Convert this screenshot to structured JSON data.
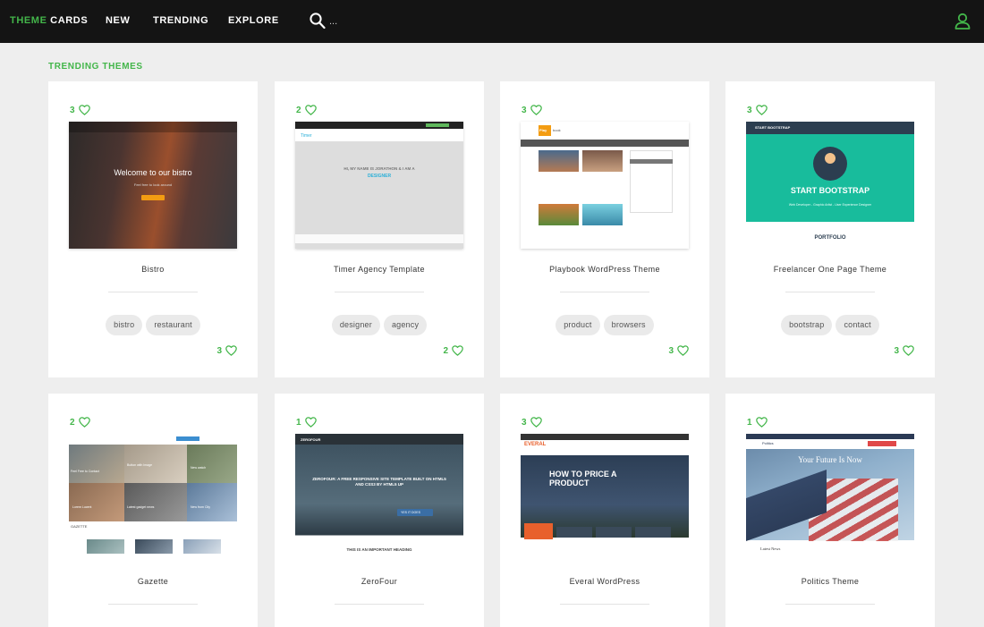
{
  "nav": {
    "brand_part1": "THEME",
    "brand_part2": "CARDS",
    "links": [
      "NEW",
      "TRENDING",
      "EXPLORE"
    ],
    "search_placeholder": "...",
    "icons": {
      "search": "search-icon",
      "user": "user-icon",
      "like": "heart-icon"
    }
  },
  "colors": {
    "accent": "#43b64a",
    "navbar": "#141414",
    "background": "#eeeeee",
    "card": "#ffffff"
  },
  "section_title": "TRENDING THEMES",
  "cards": [
    {
      "title": "Bistro",
      "likes_top": "3",
      "likes_bottom": "3",
      "tags": [
        "bistro",
        "restaurant"
      ],
      "thumb": {
        "headline": "Welcome to our bistro",
        "sub": "Feel free to look around"
      }
    },
    {
      "title": "Timer Agency Template",
      "likes_top": "2",
      "likes_bottom": "2",
      "tags": [
        "designer",
        "agency"
      ],
      "thumb": {
        "headline": "HI, MY NAME IS JORATHON & I AM A",
        "sub": "DESIGNER",
        "logo": "Timer"
      }
    },
    {
      "title": "Playbook WordPress Theme",
      "likes_top": "3",
      "likes_bottom": "3",
      "tags": [
        "product",
        "browsers"
      ],
      "thumb": {
        "logo": "Play",
        "logo_suffix": "book"
      }
    },
    {
      "title": "Freelancer One Page Theme",
      "likes_top": "3",
      "likes_bottom": "3",
      "tags": [
        "bootstrap",
        "contact"
      ],
      "thumb": {
        "nav_title": "START BOOTSTRAP",
        "headline": "START BOOTSTRAP",
        "sub": "Web Developer - Graphic Artist - User Experience Designer",
        "section": "PORTFOLIO"
      }
    },
    {
      "title": "Gazette",
      "likes_top": "2",
      "likes_bottom": "",
      "tags": [],
      "thumb": {
        "logo": "GAZETTE",
        "captions": [
          "Feel Free to Contact",
          "Button with Image",
          "New watch",
          "Lorem Lucent",
          "Latest gadget news",
          "New from City"
        ]
      }
    },
    {
      "title": "ZeroFour",
      "likes_top": "1",
      "likes_bottom": "",
      "tags": [],
      "thumb": {
        "logo": "ZEROFOUR",
        "headline": "ZEROFOUR: A FREE RESPONSIVE SITE TEMPLATE BUILT ON HTML5 AND CSS3 BY HTML5 UP",
        "button": "YES IT DOES",
        "heading": "THIS IS AN IMPORTANT HEADING"
      }
    },
    {
      "title": "Everal WordPress",
      "likes_top": "3",
      "likes_bottom": "",
      "tags": [],
      "thumb": {
        "logo": "EVERAL",
        "headline": "HOW TO PRICE A PRODUCT"
      }
    },
    {
      "title": "Politics Theme",
      "likes_top": "1",
      "likes_bottom": "",
      "tags": [],
      "thumb": {
        "logo": "Politics",
        "headline": "Your Future Is Now",
        "section": "Latest News"
      }
    }
  ]
}
